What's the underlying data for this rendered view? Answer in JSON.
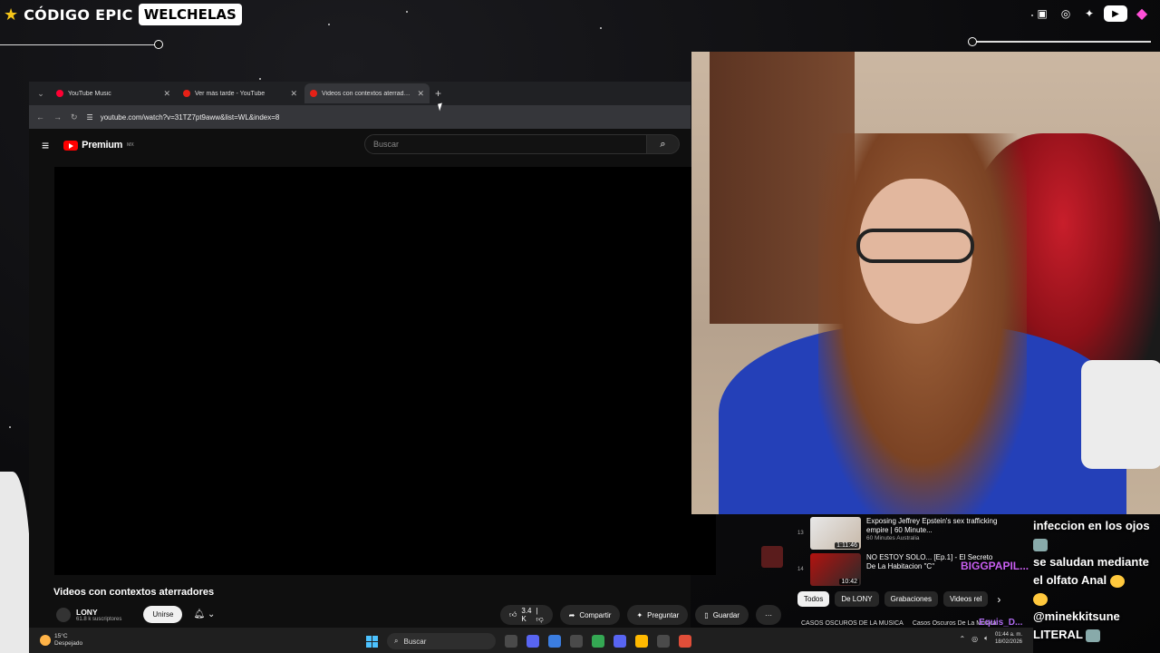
{
  "overlay": {
    "brand_code": "CÓDIGO EPIC",
    "brand_tag": "WELCHELAS",
    "socials": [
      "twitch-icon",
      "instagram-icon",
      "twitter-icon",
      "youtube-icon",
      "gem-icon"
    ]
  },
  "browser": {
    "tabs": [
      {
        "label": "YouTube Music",
        "close": "✕"
      },
      {
        "label": "Ver más tarde - YouTube",
        "close": "✕"
      },
      {
        "label": "Videos con contextos aterradores",
        "close": "✕"
      }
    ],
    "new_tab": "+",
    "url": "youtube.com/watch?v=31TZ7pt9aww&list=WL&index=8"
  },
  "youtube": {
    "logo_text": "Premium",
    "logo_region": "MX",
    "search_placeholder": "Buscar",
    "video_title": "Videos con contextos aterradores",
    "channel_name": "LONY",
    "channel_subs": "61.8 k suscriptores",
    "join_label": "Unirse",
    "like_count": "3.4 K",
    "share_label": "Compartir",
    "ask_label": "Preguntar",
    "save_label": "Guardar",
    "more_label": "···"
  },
  "recommendations": [
    {
      "index": "13",
      "duration": "1:11:46",
      "title": "Exposing Jeffrey Epstein's sex trafficking empire | 60 Minute...",
      "channel": "60 Minutes Australia"
    },
    {
      "index": "14",
      "duration": "10:42",
      "title": "NO ESTOY SOLO... [Ep.1] - El Secreto De La Habitacion \"C\"",
      "channel": ""
    }
  ],
  "chips": [
    "Todos",
    "De LONY",
    "Grabaciones",
    "Videos rel"
  ],
  "below_strip": [
    "CASOS OSCUROS DE LA MUSICA",
    "Casos Oscuros De La Música"
  ],
  "overlay_names": [
    "BIGGPAPIL...",
    "Equis_D..."
  ],
  "chat": [
    "infeccion en los ojos",
    "se saludan mediante",
    "el olfato Anal",
    "@minekkitsune",
    "LITERAL"
  ],
  "taskbar": {
    "temp": "15°C",
    "condition": "Despejado",
    "search_label": "Buscar",
    "time": "01:44 a. m.",
    "date": "18/02/2026"
  },
  "colors": {
    "accent_red": "#ff0000",
    "chat_name_purple": "#c95ff2",
    "webcam_shirt": "#2440b8"
  }
}
